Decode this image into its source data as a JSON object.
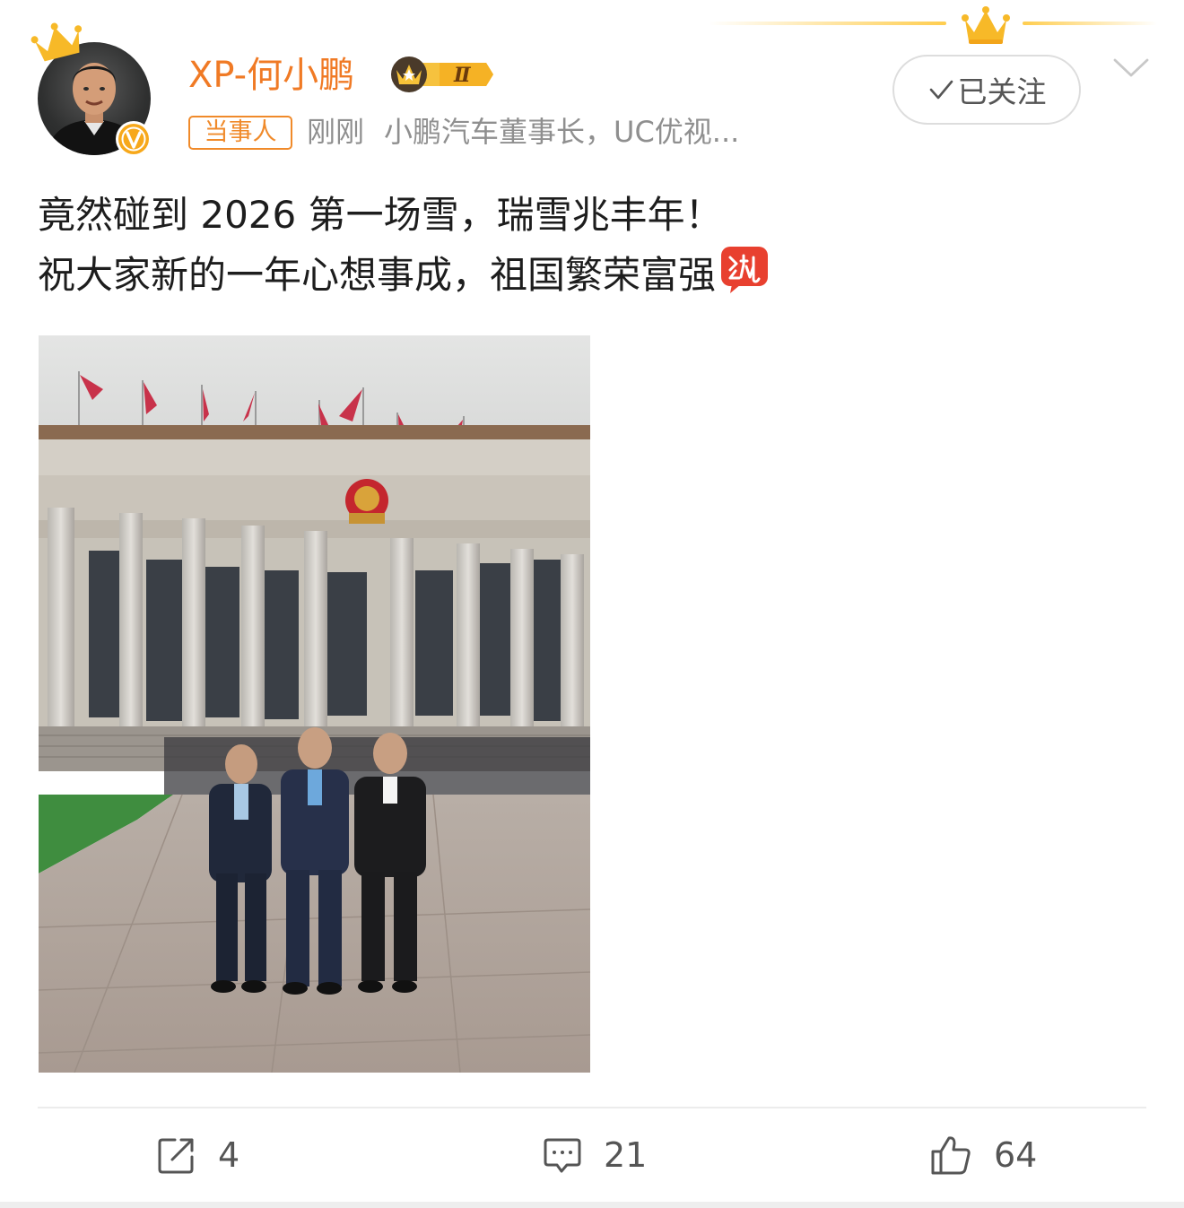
{
  "post": {
    "author": {
      "name": "XP-何小鹏",
      "level_badge": "Ⅱ",
      "tag": "当事人",
      "time": "刚刚",
      "bio": "小鹏汽车董事长，UC优视...",
      "follow_label": "已关注"
    },
    "text": {
      "line1": "竟然碰到 2026 第一场雪，瑞雪兆丰年！",
      "line2": "祝大家新的一年心想事成，祖国繁荣富强"
    },
    "emoji": "move-icon",
    "actions": {
      "repost_count": "4",
      "comment_count": "21",
      "like_count": "64"
    }
  },
  "colors": {
    "username": "#f07a25",
    "tag": "#f08a2a",
    "meta": "#8f8f8f",
    "crown_gold": "#f7b928",
    "flag_red": "#c8324a"
  }
}
